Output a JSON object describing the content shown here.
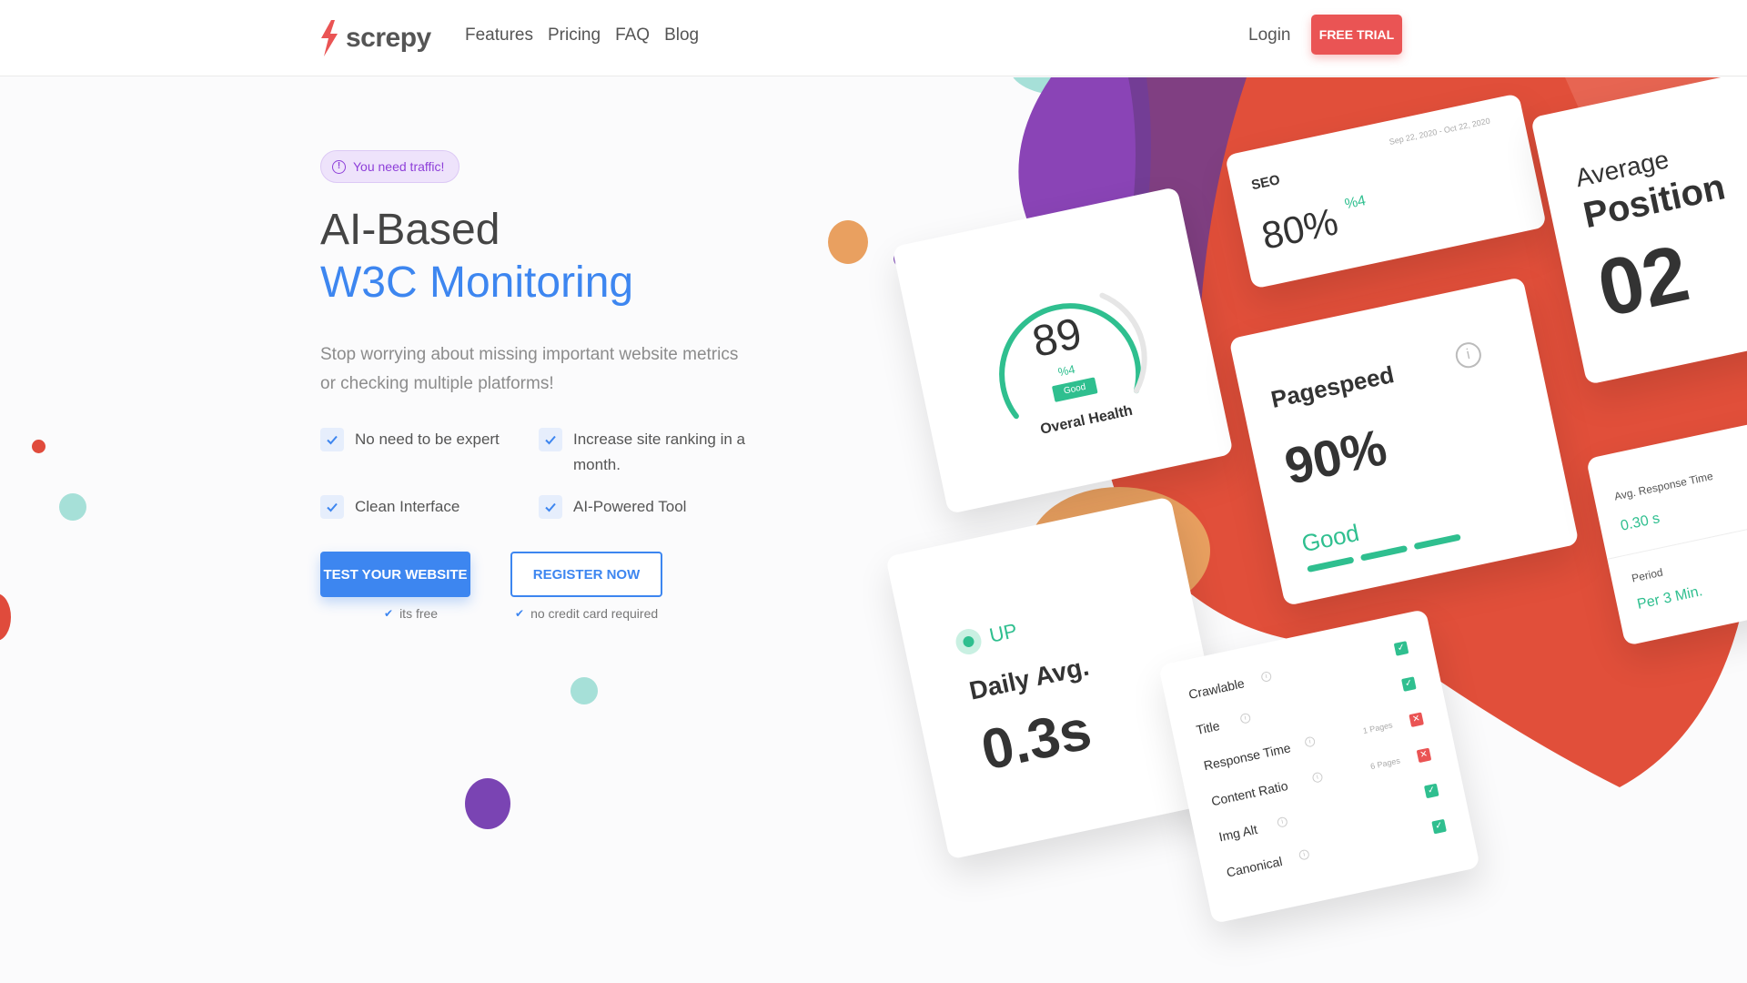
{
  "brand": {
    "name": "screpy",
    "accent": "#ea5454",
    "primary": "#3d86f0"
  },
  "nav": {
    "items": [
      "Features",
      "Pricing",
      "FAQ",
      "Blog"
    ],
    "login": "Login",
    "trial": "FREE TRIAL"
  },
  "hero": {
    "badge": "You need traffic!",
    "badge_icon": "info-icon",
    "title_line1": "AI-Based",
    "title_line2": "W3C Monitoring",
    "subtitle": "Stop worrying about missing important website metrics or checking multiple platforms!",
    "features": [
      "No need to be expert",
      "Increase site ranking in a month.",
      "Clean Interface",
      "AI-Powered Tool"
    ],
    "primary_button": "TEST YOUR WEBSITE",
    "secondary_button": "REGISTER NOW",
    "primary_note": "its free",
    "secondary_note": "no credit card required"
  },
  "cards": {
    "health": {
      "score": "89",
      "change": "%4",
      "status": "Good",
      "label": "Overal Health"
    },
    "seo": {
      "label": "SEO",
      "dates": "Sep 22, 2020 - Oct 22, 2020",
      "value": "80%",
      "change": "%4"
    },
    "position": {
      "label1": "Average",
      "label2": "Position",
      "value": "02"
    },
    "pagespeed": {
      "label": "Pagespeed",
      "value": "90%",
      "status": "Good"
    },
    "response": {
      "label": "Avg. Response Time",
      "value": "0.30 s",
      "period_label": "Period",
      "period_value": "Per 3 Min."
    },
    "uptime": {
      "status": "UP",
      "label": "Daily Avg.",
      "value": "0.3s"
    },
    "checks": [
      {
        "label": "Crawlable",
        "note": "",
        "status": "pass"
      },
      {
        "label": "Title",
        "note": "",
        "status": "pass"
      },
      {
        "label": "Response Time",
        "note": "1 Pages",
        "status": "fail"
      },
      {
        "label": "Content Ratio",
        "note": "6 Pages",
        "status": "fail"
      },
      {
        "label": "Img Alt",
        "note": "",
        "status": "pass"
      },
      {
        "label": "Canonical",
        "note": "",
        "status": "pass"
      }
    ]
  }
}
